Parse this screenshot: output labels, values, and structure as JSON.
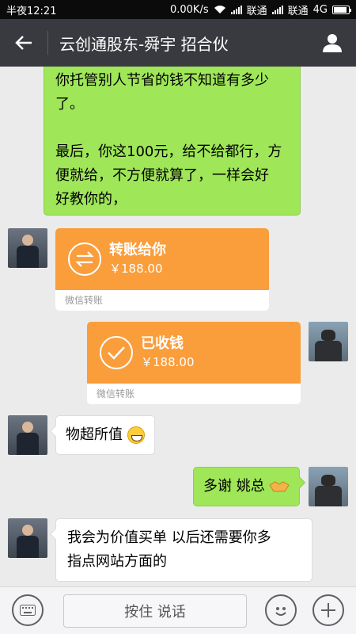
{
  "status_bar": {
    "time": "半夜12:21",
    "speed": "0.00K/s",
    "carrier1": "联通",
    "carrier2": "联通",
    "network": "4G",
    "battery_level": 0.9
  },
  "header": {
    "back_icon": "back-arrow-icon",
    "title": "云创通股东-舜宇 招合伙",
    "profile_icon": "person-icon"
  },
  "messages": [
    {
      "type": "text",
      "from": "me",
      "text": "你托管别人节省的钱不知道有多少\n了。\n\n最后，你这100元，给不给都行，方\n便就给，不方便就算了，一样会好\n好教你的，"
    },
    {
      "type": "transfer",
      "from": "other",
      "title": "转账给你",
      "amount": "￥188.00",
      "footer": "微信转账",
      "icon": "transfer-arrows-icon"
    },
    {
      "type": "transfer",
      "from": "me",
      "title": "已收钱",
      "amount": "￥188.00",
      "footer": "微信转账",
      "icon": "checkmark-icon"
    },
    {
      "type": "text",
      "from": "other",
      "text": "物超所值",
      "emoji": "grinning-face-emoji"
    },
    {
      "type": "text",
      "from": "me",
      "text": "多谢 姚总",
      "emoji": "handshake-emoji"
    },
    {
      "type": "text",
      "from": "other",
      "text": "我会为价值买单 以后还需要你多\n指点网站方面的"
    }
  ],
  "input_bar": {
    "keyboard_icon": "keyboard-icon",
    "voice_label": "按住 说话",
    "emoji_icon": "smiley-icon",
    "plus_icon": "plus-icon"
  },
  "colors": {
    "header_bg": "#393a3f",
    "chat_bg": "#ebebeb",
    "my_bubble": "#9fe658",
    "transfer_orange": "#fa9d3b"
  }
}
